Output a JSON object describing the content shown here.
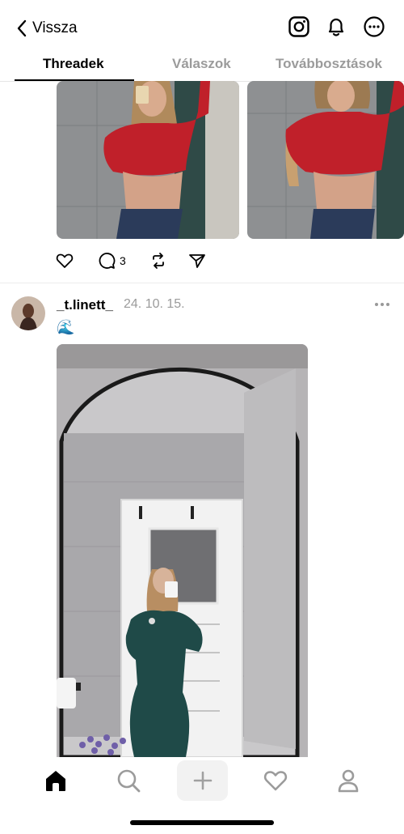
{
  "header": {
    "back_label": "Vissza",
    "icons": [
      "instagram-icon",
      "bell-icon",
      "more-circle-icon"
    ]
  },
  "tabs": [
    {
      "label": "Threadek",
      "active": true
    },
    {
      "label": "Válaszok",
      "active": false
    },
    {
      "label": "Továbbosztások",
      "active": false
    }
  ],
  "post1": {
    "reply_count": "3",
    "actions": [
      "heart-icon",
      "comment-icon",
      "repost-icon",
      "send-icon"
    ]
  },
  "post2": {
    "author": "_t.linett_",
    "date": "24. 10. 15.",
    "emoji": "🌊"
  },
  "bottom_nav": [
    "home-icon",
    "search-icon",
    "plus-icon",
    "heart-icon",
    "profile-icon"
  ],
  "colors": {
    "muted": "#9b9b9b",
    "shirt_red": "#c0202a",
    "dress_green": "#1f4a48"
  }
}
